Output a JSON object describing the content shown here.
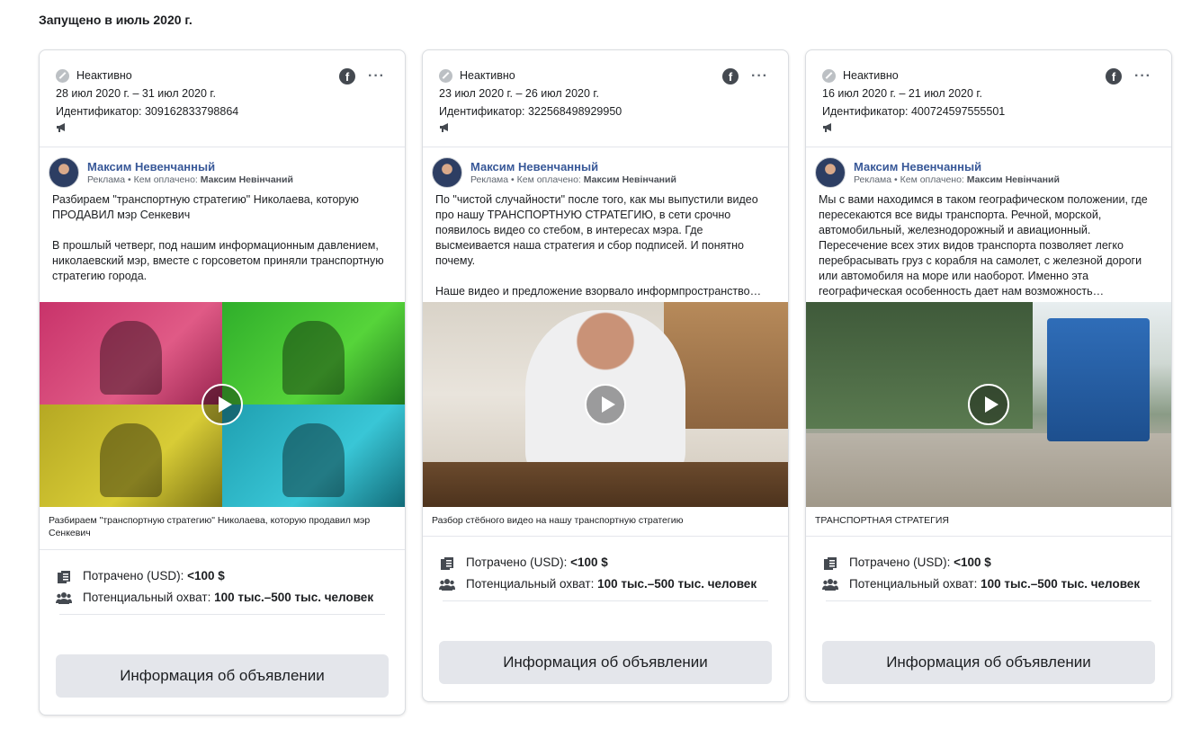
{
  "section_title": "Запущено в июль 2020 г.",
  "cards": [
    {
      "status": "Неактивно",
      "dates": "28 июл 2020 г. – 31 июл 2020 г.",
      "id_label": "Идентификатор: 309162833798864",
      "page_name": "Максим Невенчанный",
      "sponsor_prefix": "Реклама • Кем оплачено:",
      "sponsor_name": "Максим Невінчаний",
      "body": "Разбираем \"транспортную стратегию\" Николаева, которую ПРОДАВИЛ мэр Сенкевич\n\nВ прошлый четверг, под нашим информационным давлением, николаевский мэр, вместе с горсоветом приняли транспортную стратегию города.",
      "caption": "Разбираем \"транспортную стратегию\" Николаева, которую продавил мэр Сенкевич",
      "spent_label": "Потрачено (USD):",
      "spent_value": "<100 $",
      "reach_label": "Потенциальный охват:",
      "reach_value": "100 тыс.–500 тыс. человек",
      "button": "Информация об объявлении"
    },
    {
      "status": "Неактивно",
      "dates": "23 июл 2020 г. – 26 июл 2020 г.",
      "id_label": "Идентификатор: 322568498929950",
      "page_name": "Максим Невенчанный",
      "sponsor_prefix": "Реклама • Кем оплачено:",
      "sponsor_name": "Максим Невінчаний",
      "body": "По \"чистой случайности\" после того, как мы выпустили видео про нашу ТРАНСПОРТНУЮ СТРАТЕГИЮ, в сети срочно появилось видео со стебом, в интересах мэра. Где высмеивается наша стратегия и сбор подписей. И понятно почему.\n\nНаше видео и предложение взорвало информпространство…",
      "caption": "Разбор стёбного видео на нашу транспортную стратегию",
      "spent_label": "Потрачено (USD):",
      "spent_value": "<100 $",
      "reach_label": "Потенциальный охват:",
      "reach_value": "100 тыс.–500 тыс. человек",
      "button": "Информация об объявлении"
    },
    {
      "status": "Неактивно",
      "dates": "16 июл 2020 г. – 21 июл 2020 г.",
      "id_label": "Идентификатор: 400724597555501",
      "page_name": "Максим Невенчанный",
      "sponsor_prefix": "Реклама • Кем оплачено:",
      "sponsor_name": "Максим Невінчаний",
      "body": "Мы с вами находимся в таком географическом положении, где пересекаются все виды транспорта. Речной, морской, автомобильный, железнодорожный и авиационный. Пересечение всех этих видов транспорта позволяет легко перебрасывать груз с корабля на самолет, с железной дороги или автомобиля на море или наоборот. Именно эта географическая особенность дает нам возможность…",
      "caption": "ТРАНСПОРТНАЯ СТРАТЕГИЯ",
      "spent_label": "Потрачено (USD):",
      "spent_value": "<100 $",
      "reach_label": "Потенциальный охват:",
      "reach_value": "100 тыс.–500 тыс. человек",
      "button": "Информация об объявлении"
    }
  ],
  "icons": {
    "status": "inactive-icon",
    "platform": "facebook-icon",
    "menu": "more-icon",
    "ad_type": "megaphone-icon",
    "spent": "receipt-icon",
    "reach": "people-icon",
    "play": "play-icon"
  }
}
